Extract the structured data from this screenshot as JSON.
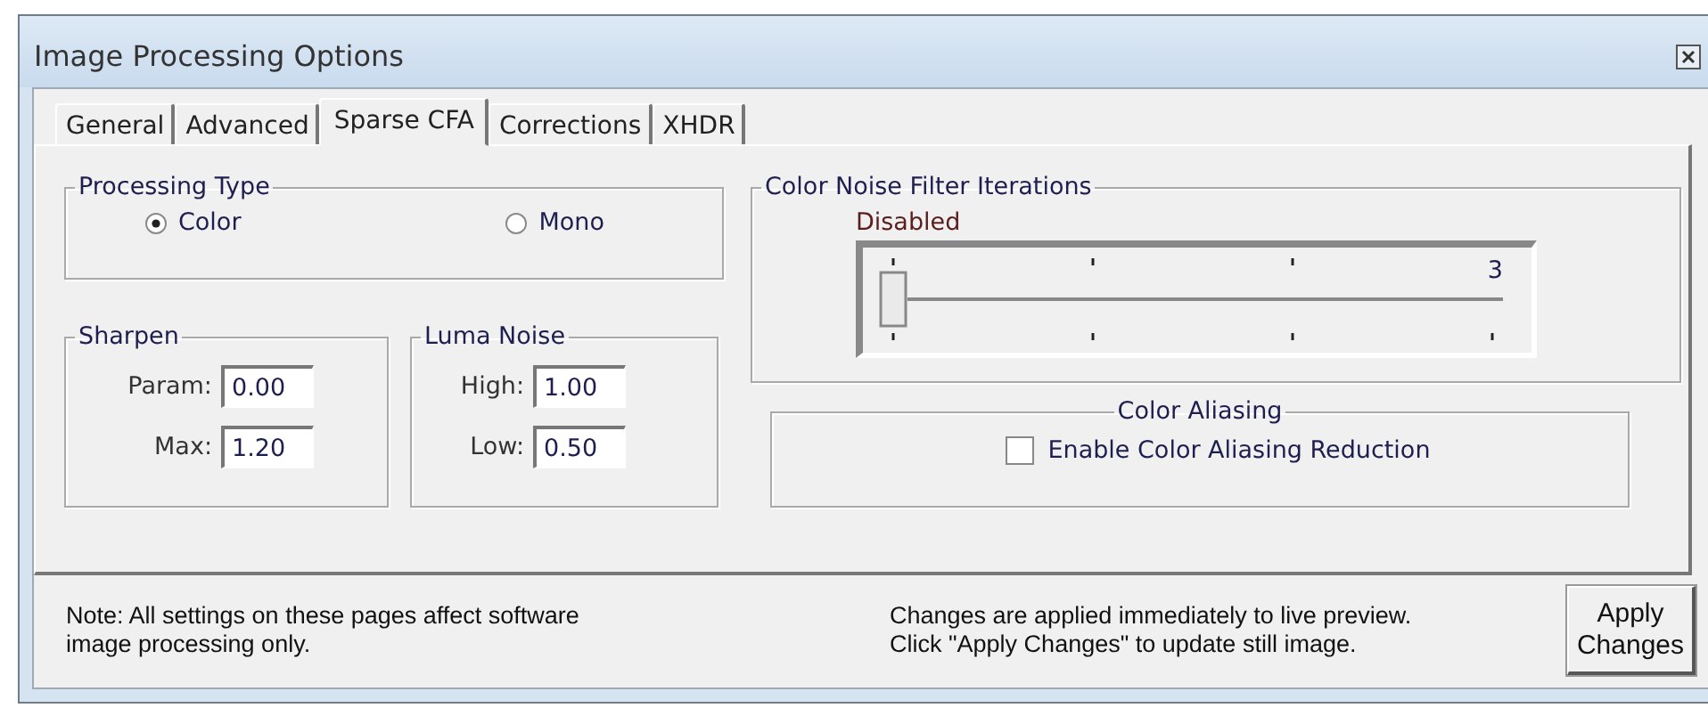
{
  "window": {
    "title": "Image Processing Options"
  },
  "tabs": [
    {
      "label": "General",
      "selected": false
    },
    {
      "label": "Advanced",
      "selected": false
    },
    {
      "label": "Sparse CFA",
      "selected": true
    },
    {
      "label": "Corrections",
      "selected": false
    },
    {
      "label": "XHDR",
      "selected": false
    }
  ],
  "processing_type": {
    "title": "Processing Type",
    "options": [
      {
        "label": "Color",
        "selected": true
      },
      {
        "label": "Mono",
        "selected": false
      }
    ]
  },
  "sharpen": {
    "title": "Sharpen",
    "fields": [
      {
        "label": "Param:",
        "value": "0.00"
      },
      {
        "label": "Max:",
        "value": "1.20"
      }
    ]
  },
  "luma_noise": {
    "title": "Luma Noise",
    "fields": [
      {
        "label": "High:",
        "value": "1.00"
      },
      {
        "label": "Low:",
        "value": "0.50"
      }
    ]
  },
  "color_noise": {
    "title": "Color Noise Filter Iterations",
    "min_label": "Disabled",
    "max_label": "3",
    "level": 0
  },
  "color_aliasing": {
    "title": "Color Aliasing",
    "checkbox": {
      "label": "Enable Color Aliasing Reduction",
      "checked": false
    }
  },
  "notes": [
    "Note: All settings on these pages affect software\nimage processing only.",
    "Changes are applied immediately to live preview.\nClick \"Apply Changes\" to update still image."
  ],
  "apply_button": "Apply\nChanges"
}
